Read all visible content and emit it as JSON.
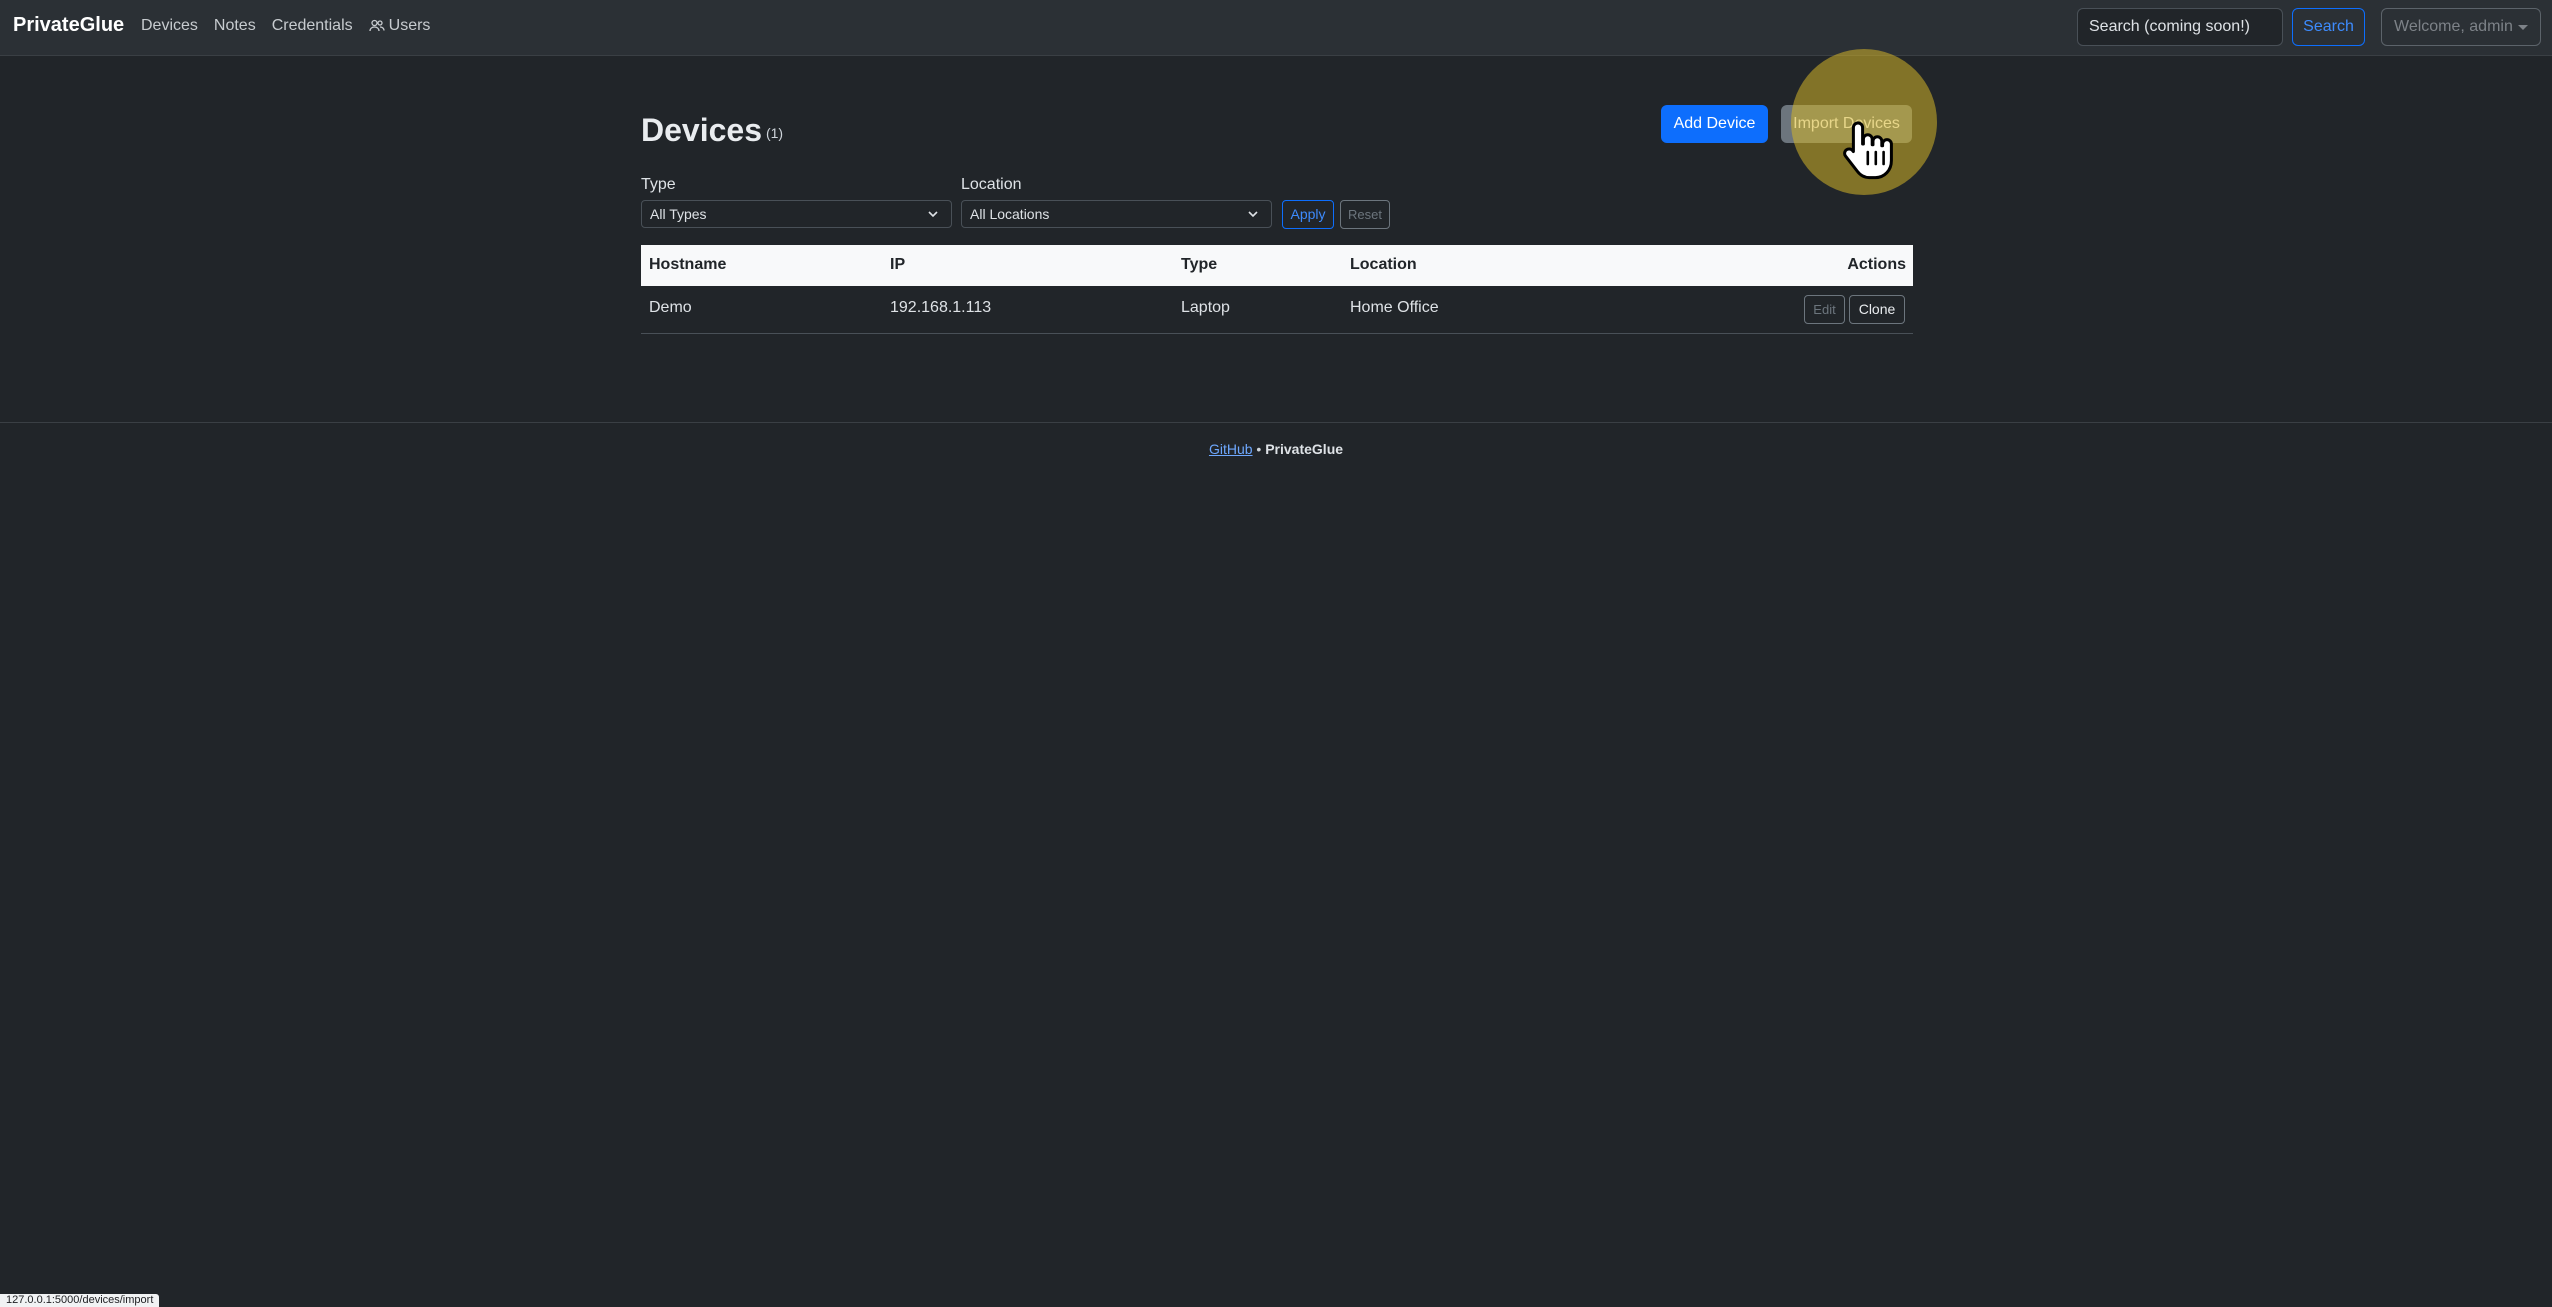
{
  "app": {
    "brand": "PrivateGlue"
  },
  "nav": {
    "items": [
      {
        "label": "Devices"
      },
      {
        "label": "Notes"
      },
      {
        "label": "Credentials"
      },
      {
        "label": "Users",
        "icon": "users-icon"
      }
    ],
    "search_placeholder": "Search (coming soon!)",
    "search_button": "Search",
    "user_menu": "Welcome, admin"
  },
  "page": {
    "title": "Devices",
    "count": "(1)",
    "add_button": "Add Device",
    "import_button": "Import Devices"
  },
  "filters": {
    "type_label": "Type",
    "type_value": "All Types",
    "location_label": "Location",
    "location_value": "All Locations",
    "apply": "Apply",
    "reset": "Reset"
  },
  "table": {
    "headers": [
      "Hostname",
      "IP",
      "Type",
      "Location",
      "Actions"
    ],
    "rows": [
      {
        "hostname": "Demo",
        "ip": "192.168.1.113",
        "type": "Laptop",
        "location": "Home Office",
        "edit": "Edit",
        "clone": "Clone"
      }
    ]
  },
  "footer": {
    "link": "GitHub",
    "separator": "•",
    "brand": "PrivateGlue"
  },
  "status_bar": {
    "url": "127.0.0.1:5000/devices/import"
  },
  "colors": {
    "background": "#212529",
    "navbar": "#2b3035",
    "primary": "#0d6efd",
    "secondary": "#6c757d",
    "cursor_highlight": "#d4b428"
  }
}
